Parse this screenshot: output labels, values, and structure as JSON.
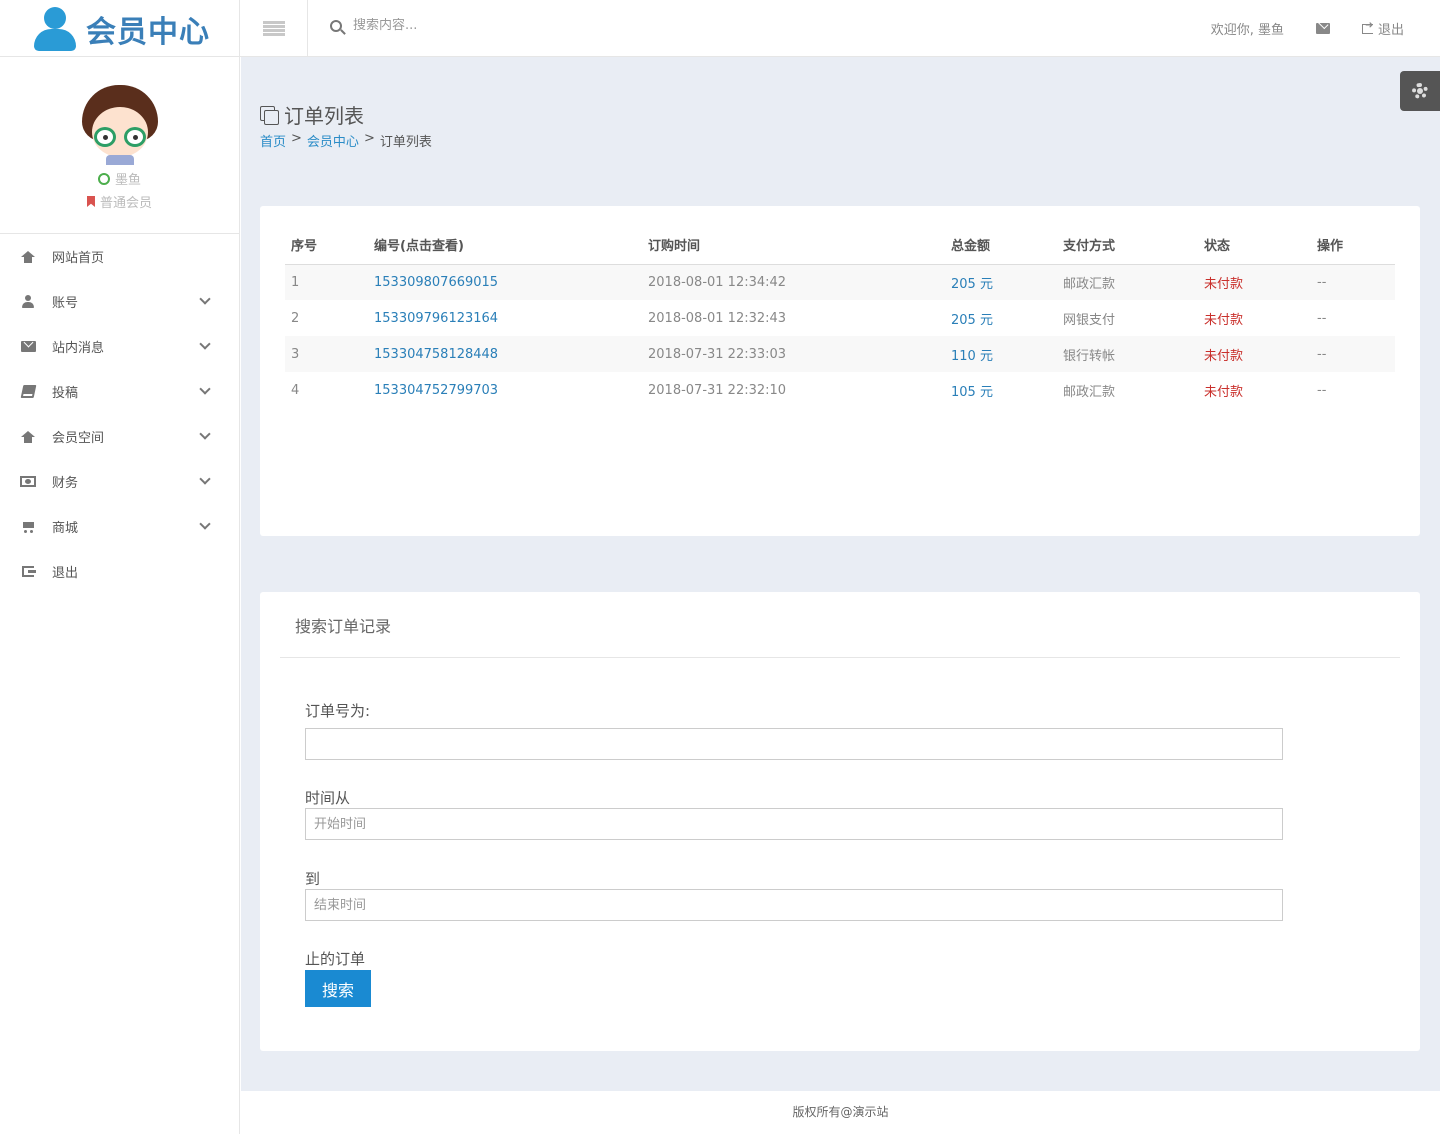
{
  "header": {
    "logo_text": "会员中心",
    "search_placeholder": "搜索内容...",
    "welcome": "欢迎你, 墨鱼",
    "logout": "退出"
  },
  "profile": {
    "name": "墨鱼",
    "level": "普通会员"
  },
  "sidebar": {
    "items": [
      {
        "label": "网站首页",
        "icon": "home-icon",
        "expandable": false
      },
      {
        "label": "账号",
        "icon": "user-icon",
        "expandable": true
      },
      {
        "label": "站内消息",
        "icon": "envelope-icon",
        "expandable": true
      },
      {
        "label": "投稿",
        "icon": "book-icon",
        "expandable": true
      },
      {
        "label": "会员空间",
        "icon": "home-icon",
        "expandable": true
      },
      {
        "label": "财务",
        "icon": "money-icon",
        "expandable": true
      },
      {
        "label": "商城",
        "icon": "cart-icon",
        "expandable": true
      },
      {
        "label": "退出",
        "icon": "sign-out-icon",
        "expandable": false
      }
    ]
  },
  "page": {
    "title": "订单列表",
    "breadcrumb": [
      "首页",
      "会员中心",
      "订单列表"
    ],
    "breadcrumb_sep": ">"
  },
  "orders": {
    "columns": [
      "序号",
      "编号(点击查看)",
      "订购时间",
      "总金额",
      "支付方式",
      "状态",
      "操作"
    ],
    "rows": [
      {
        "index": "1",
        "order_no": "153309807669015",
        "time": "2018-08-01 12:34:42",
        "amount": "205 元",
        "payment": "邮政汇款",
        "status": "未付款",
        "action": "--"
      },
      {
        "index": "2",
        "order_no": "153309796123164",
        "time": "2018-08-01 12:32:43",
        "amount": "205 元",
        "payment": "网银支付",
        "status": "未付款",
        "action": "--"
      },
      {
        "index": "3",
        "order_no": "153304758128448",
        "time": "2018-07-31 22:33:03",
        "amount": "110 元",
        "payment": "银行转帐",
        "status": "未付款",
        "action": "--"
      },
      {
        "index": "4",
        "order_no": "153304752799703",
        "time": "2018-07-31 22:32:10",
        "amount": "105 元",
        "payment": "邮政汇款",
        "status": "未付款",
        "action": "--"
      }
    ]
  },
  "search_form": {
    "title": "搜索订单记录",
    "order_no_label": "订单号为:",
    "order_no_value": "",
    "from_label": "时间从",
    "from_placeholder": "开始时间",
    "to_label": "到",
    "to_placeholder": "结束时间",
    "suffix_label": "止的订单",
    "submit": "搜索"
  },
  "footer": {
    "text": "版权所有@演示站"
  },
  "colors": {
    "accent": "#1a8ad2",
    "link": "#2a7fb8",
    "status_unpaid": "#c9302c",
    "background": "#e9edf4"
  }
}
